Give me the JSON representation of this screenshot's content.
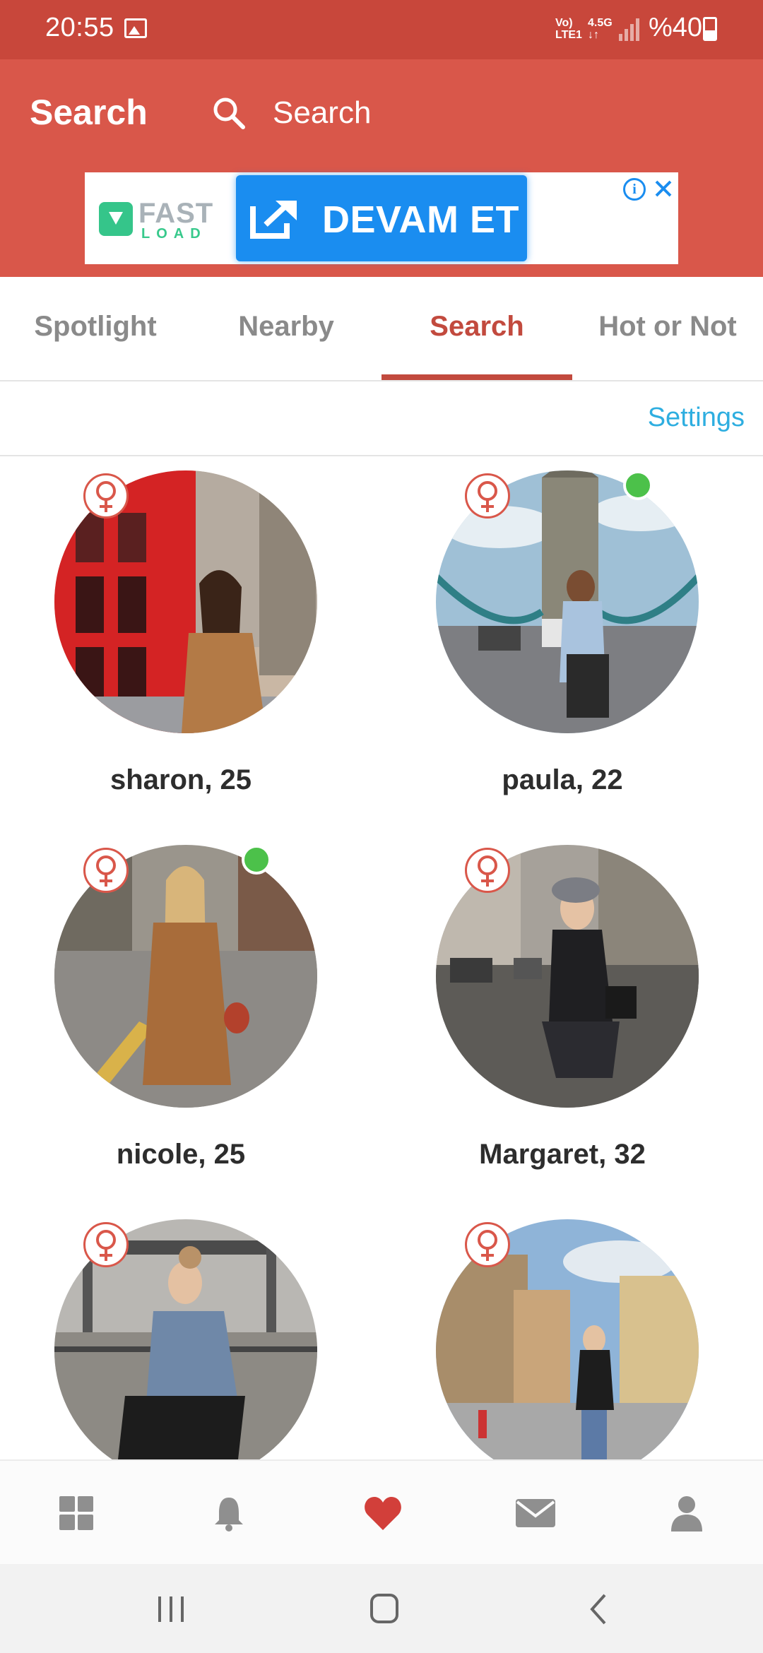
{
  "status_bar": {
    "time": "20:55",
    "net_top": "Vo)",
    "net_bottom": "LTE1",
    "lte_top": "4.5G",
    "lte_bottom": "↓↑",
    "battery": "%40"
  },
  "header": {
    "title": "Search",
    "search_placeholder": "Search",
    "accent_color": "#d9574a"
  },
  "ad": {
    "brand_top": "FAST",
    "brand_bottom": "LOAD",
    "cta_label": "DEVAM ET",
    "info_glyph": "i"
  },
  "tabs": {
    "items": [
      {
        "label": "Spotlight"
      },
      {
        "label": "Nearby"
      },
      {
        "label": "Search"
      },
      {
        "label": "Hot or Not"
      }
    ],
    "active": "Search"
  },
  "settings_label": "Settings",
  "profiles": [
    {
      "name": "sharon, 25",
      "gender": "female",
      "online": false
    },
    {
      "name": "paula, 22",
      "gender": "female",
      "online": true
    },
    {
      "name": "nicole, 25",
      "gender": "female",
      "online": true
    },
    {
      "name": "Margaret, 32",
      "gender": "female",
      "online": false
    },
    {
      "name": "",
      "gender": "female",
      "online": false
    },
    {
      "name": "",
      "gender": "female",
      "online": false
    }
  ],
  "bottom_nav": {
    "items": [
      "grid-icon",
      "bell-icon",
      "heart-icon",
      "mail-icon",
      "person-icon"
    ],
    "active": "heart-icon"
  },
  "system_nav": [
    "recents-icon",
    "home-icon",
    "back-icon"
  ],
  "colors": {
    "status_bar": "#c8473b",
    "header": "#d9574a",
    "active_tab": "#c24a3e",
    "link": "#2eaee0",
    "online": "#4cc14a",
    "cta": "#1a8df0"
  }
}
